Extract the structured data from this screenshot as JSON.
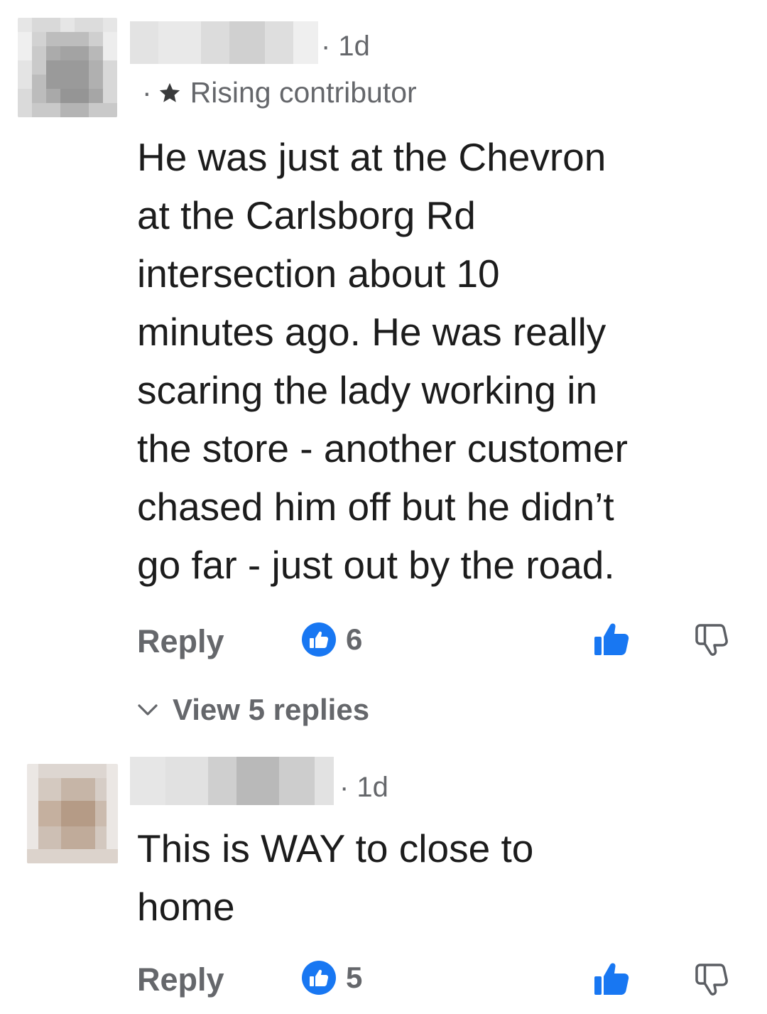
{
  "comments": [
    {
      "time": "· 1d",
      "badge_prefix": "·",
      "badge_icon": "star-icon",
      "badge_label": "Rising contributor",
      "body_lines": [
        "He was just at the Chevron",
        "at the Carlsborg Rd",
        "intersection about 10",
        "minutes ago. He was really",
        "scaring the lady working in",
        "the store - another customer",
        "chased him off but he didn’t",
        "go far - just out by the road."
      ],
      "reply_label": "Reply",
      "like_count": "6",
      "view_replies_label": "View 5 replies"
    },
    {
      "time": "· 1d",
      "body_lines": [
        "This is WAY to close to",
        "home"
      ],
      "reply_label": "Reply",
      "like_count": "5"
    }
  ],
  "colors": {
    "meta_gray": "#65676b",
    "like_blue": "#1877f2",
    "body_text": "#1c1c1c"
  },
  "icons": {
    "like_badge": "like-badge-icon",
    "thumb_up": "thumbs-up-icon",
    "thumb_down": "thumbs-down-icon",
    "chevron": "chevron-down-icon"
  }
}
